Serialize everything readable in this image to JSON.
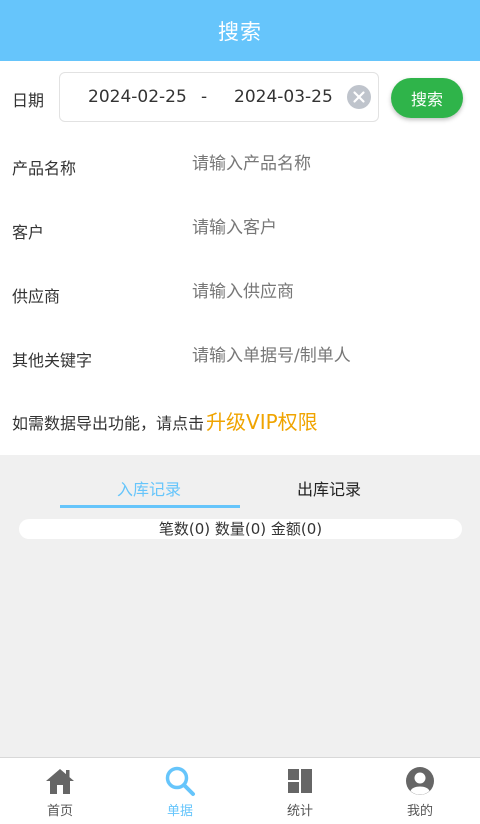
{
  "header": {
    "title": "搜索"
  },
  "date_filter": {
    "label": "日期",
    "start": "2024-02-25",
    "separator": "-",
    "end": "2024-03-25",
    "search_label": "搜索"
  },
  "fields": [
    {
      "label": "产品名称",
      "placeholder": "请输入产品名称",
      "value": ""
    },
    {
      "label": "客户",
      "placeholder": "请输入客户",
      "value": ""
    },
    {
      "label": "供应商",
      "placeholder": "请输入供应商",
      "value": ""
    },
    {
      "label": "其他关键字",
      "placeholder": "请输入单据号/制单人",
      "value": ""
    }
  ],
  "vip": {
    "text": "如需数据导出功能，请点击",
    "link": "升级VIP权限"
  },
  "records": {
    "tabs": [
      {
        "label": "入库记录",
        "active": true
      },
      {
        "label": "出库记录",
        "active": false
      }
    ],
    "summary": "笔数(0) 数量(0) 金额(0)"
  },
  "bottom_nav": [
    {
      "label": "首页",
      "icon": "home-icon",
      "active": false
    },
    {
      "label": "单据",
      "icon": "search-icon",
      "active": true
    },
    {
      "label": "统计",
      "icon": "grid-icon",
      "active": false
    },
    {
      "label": "我的",
      "icon": "user-icon",
      "active": false
    }
  ],
  "colors": {
    "header": "#66c5fb",
    "accent": "#66c5fb",
    "search_button": "#2fb44a",
    "vip_link": "#f0a400",
    "records_bg": "#f0f0f0"
  }
}
